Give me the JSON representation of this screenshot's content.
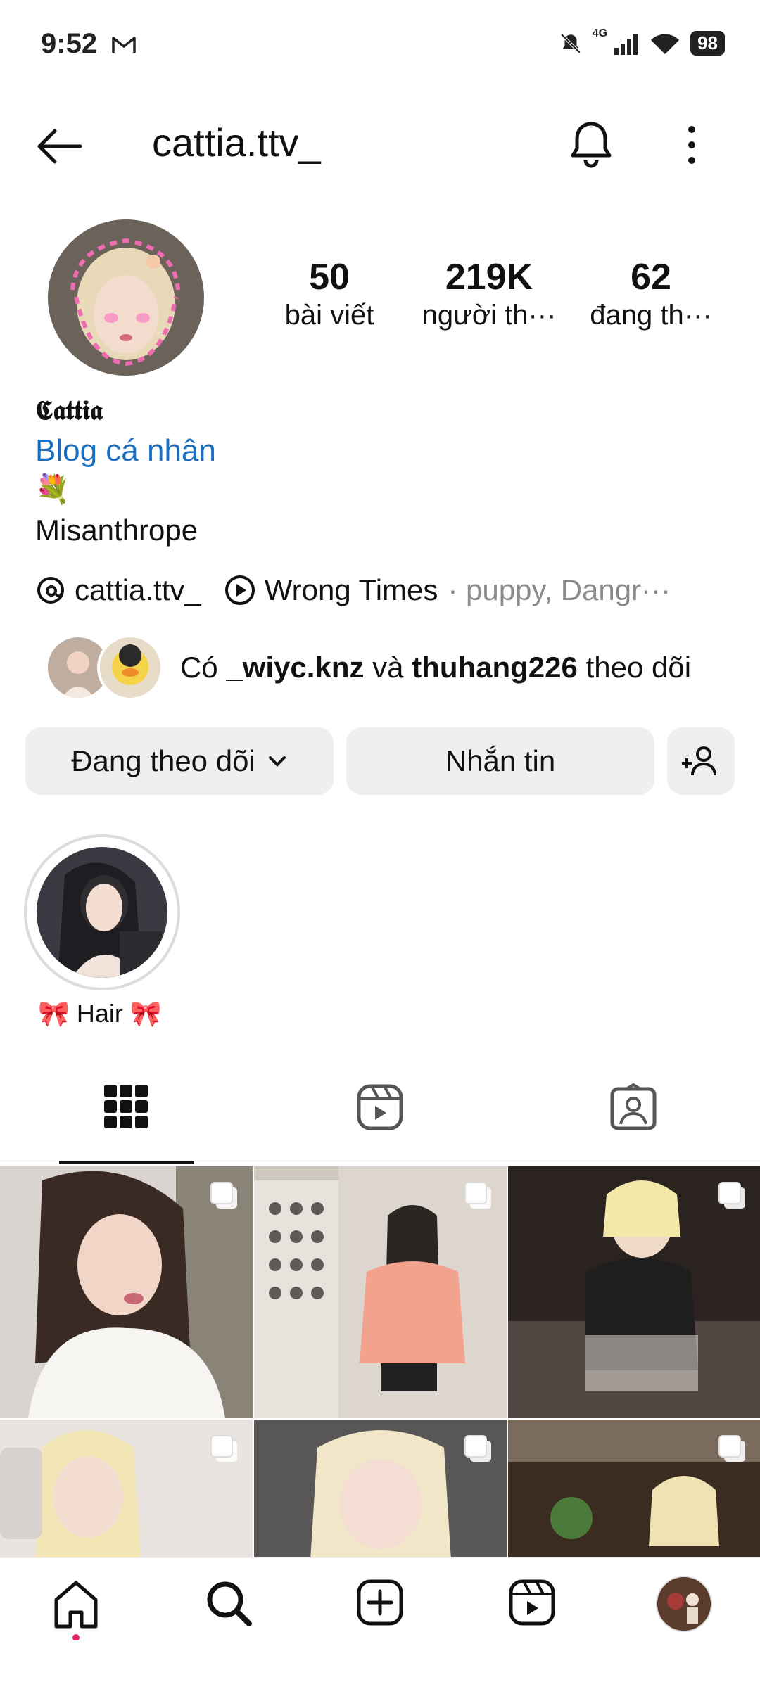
{
  "status_bar": {
    "time": "9:52",
    "network": "4G",
    "battery": "98"
  },
  "header": {
    "username": "cattia.ttv_"
  },
  "profile": {
    "stats": [
      {
        "value": "50",
        "label": "bài viết"
      },
      {
        "value": "219K",
        "label": "người th···"
      },
      {
        "value": "62",
        "label": "đang th···"
      }
    ],
    "display_name": "𝕮𝖆𝖙𝖙𝖎𝖆",
    "link": "Blog cá nhân",
    "emoji": "💐",
    "bio": "Misanthrope",
    "threads_handle": "cattia.ttv_",
    "music_title": "Wrong Times",
    "music_artists": "· puppy, Dangr···"
  },
  "followed_by": {
    "prefix": "Có",
    "user1": "_wiyc.knz",
    "joiner": "và",
    "user2": "thuhang226",
    "suffix": "theo dõi"
  },
  "actions": {
    "following_label": "Đang theo dõi",
    "message_label": "Nhắn tin"
  },
  "highlights": [
    {
      "label": "🎀 Hair 🎀"
    }
  ],
  "tabs": [
    "grid-tab",
    "reels-tab",
    "tagged-tab"
  ],
  "icons": {
    "back": "arrow-left-icon",
    "bell": "bell-icon",
    "more": "more-vertical-icon",
    "threads": "threads-icon",
    "play": "play-circle-icon",
    "add_user": "add-user-icon",
    "multi": "carousel-icon"
  },
  "colors": {
    "link": "#1a6fc4",
    "button_bg": "#efefef",
    "notification_dot": "#e0245e"
  }
}
